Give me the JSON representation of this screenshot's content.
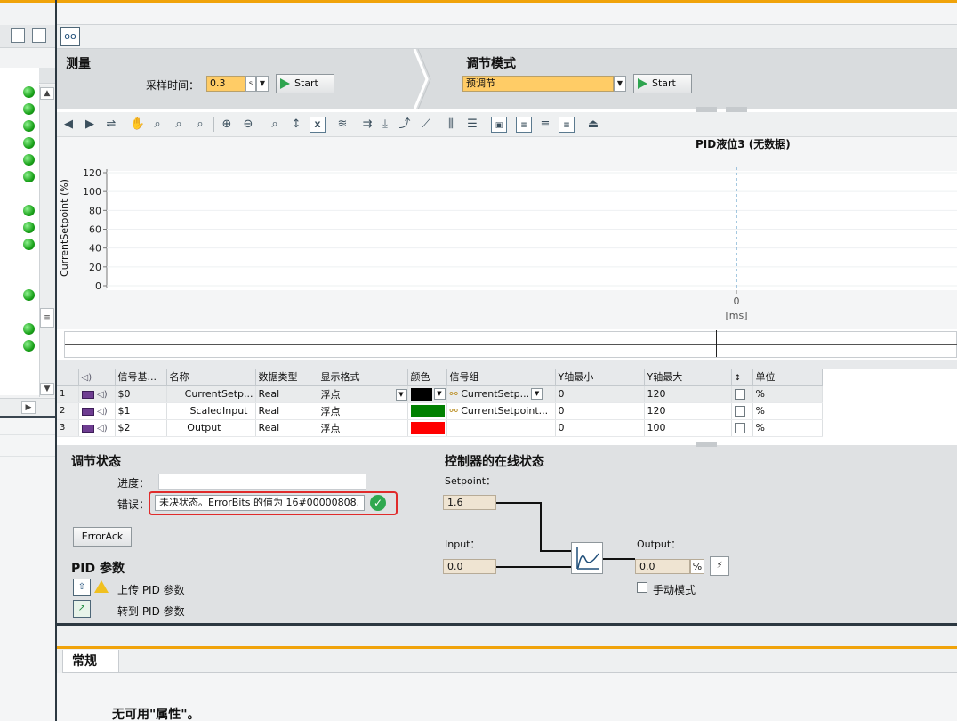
{
  "measurement": {
    "title": "测量",
    "sample_time_label": "采样时间：",
    "sample_time_value": "0.3",
    "sample_time_unit": "s",
    "start_label": "Start"
  },
  "tuning_mode": {
    "title": "调节模式",
    "mode_value": "预调节",
    "start_label": "Start"
  },
  "chart_data": {
    "type": "line",
    "title": "PID液位3 (无数据)",
    "ylabel": "CurrentSetpoint (%)",
    "xlabel": "[ms]",
    "ylim": [
      0,
      120
    ],
    "yticks": [
      0,
      20,
      40,
      60,
      80,
      100,
      120
    ],
    "xticks": [
      0
    ],
    "series": []
  },
  "signal_table": {
    "headers": [
      "信号基...",
      "名称",
      "数据类型",
      "显示格式",
      "颜色",
      "信号组",
      "Y轴最小",
      "Y轴最大",
      "单位"
    ],
    "rows": [
      {
        "num": "1",
        "addr": "$0",
        "name": "CurrentSetp...",
        "type": "Real",
        "format": "浮点",
        "color": "#000000",
        "group": "CurrentSetp...",
        "ymin": "0",
        "ymax": "120",
        "unit": "%"
      },
      {
        "num": "2",
        "addr": "$1",
        "name": "ScaledInput",
        "type": "Real",
        "format": "浮点",
        "color": "#008000",
        "group": "CurrentSetpoint...",
        "ymin": "0",
        "ymax": "120",
        "unit": "%"
      },
      {
        "num": "3",
        "addr": "$2",
        "name": "Output",
        "type": "Real",
        "format": "浮点",
        "color": "#ff0000",
        "group": "",
        "ymin": "0",
        "ymax": "100",
        "unit": "%"
      }
    ]
  },
  "tuning_status": {
    "title": "调节状态",
    "progress_label": "进度：",
    "error_label": "错误：",
    "error_text": "未决状态。ErrorBits 的值为 16#00000808.",
    "errorack_label": "ErrorAck"
  },
  "pid_params": {
    "title": "PID 参数",
    "upload_label": "上传 PID 参数",
    "goto_label": "转到 PID 参数"
  },
  "online_status": {
    "title": "控制器的在线状态",
    "setpoint_label": "Setpoint：",
    "setpoint_value": "1.6",
    "input_label": "Input：",
    "input_value": "0.0",
    "output_label": "Output：",
    "output_value": "0.0",
    "output_unit": "%",
    "manual_label": "手动模式"
  },
  "properties": {
    "tab_label": "常规",
    "message": "无可用\"属性\"。"
  }
}
